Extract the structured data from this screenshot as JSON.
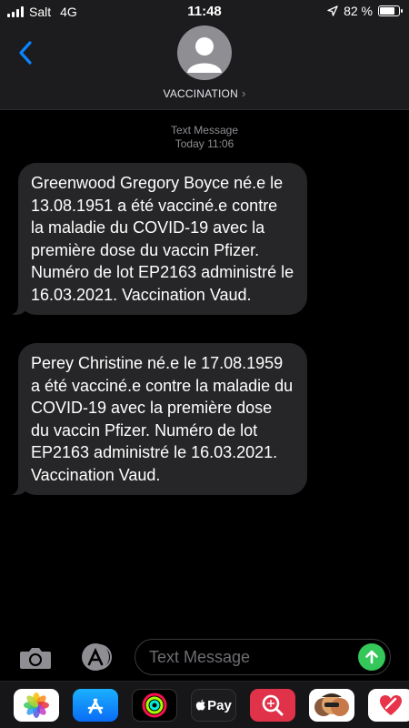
{
  "status_bar": {
    "carrier": "Salt",
    "network": "4G",
    "time": "11:48",
    "battery": "82 %",
    "battery_level": 0.82
  },
  "header": {
    "contact_name": "VACCINATION",
    "chevron": "›"
  },
  "conversation": {
    "meta_type": "Text Message",
    "meta_time": "Today 11:06",
    "messages": [
      {
        "text": "Greenwood Gregory Boyce né.e le 13.08.1951 a été vacciné.e contre la maladie du COVID-19 avec la première dose du vaccin Pfizer. Numéro de lot EP2163 administré le 16.03.2021. Vaccination Vaud."
      },
      {
        "text": "Perey Christine né.e le 17.08.1959 a été vacciné.e contre la maladie du COVID-19 avec la première dose du vaccin Pfizer. Numéro de lot EP2163 administré le 16.03.2021. Vaccination Vaud."
      }
    ]
  },
  "composer": {
    "placeholder": "Text Message"
  },
  "app_drawer": {
    "apps": [
      {
        "icon": "photos-icon"
      },
      {
        "icon": "app-store-icon"
      },
      {
        "icon": "activity-icon"
      },
      {
        "icon": "apple-pay-icon",
        "label": "Pay"
      },
      {
        "icon": "web-search-icon"
      },
      {
        "icon": "memoji-icon"
      },
      {
        "icon": "heart-sticker-icon"
      }
    ]
  },
  "colors": {
    "accent": "#0a84ff",
    "send": "#34c759",
    "bubble": "#262628",
    "header_bg": "#1c1c1e"
  }
}
